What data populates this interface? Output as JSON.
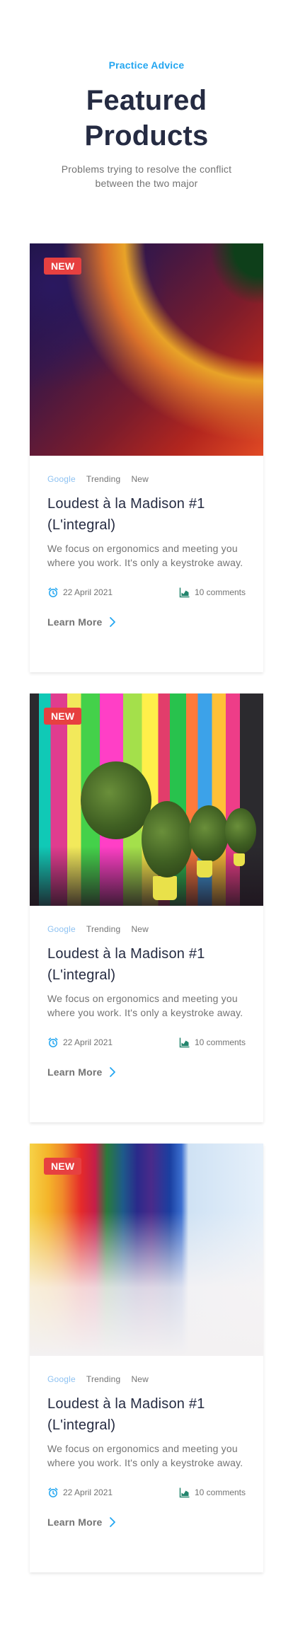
{
  "header": {
    "eyebrow": "Practice Advice",
    "title_line1": "Featured",
    "title_line2": "Products",
    "subtitle": "Problems trying to resolve the conflict between the two major"
  },
  "colors": {
    "primary": "#23A6F0",
    "heading": "#252B42",
    "muted": "#737373",
    "badge": "#E74040",
    "active_tag": "#8EC2F2",
    "icon_green": "#23856D"
  },
  "cards": [
    {
      "badge": "NEW",
      "image": "abstract-gradient-image",
      "tags": [
        "Google",
        "Trending",
        "New"
      ],
      "title": "Loudest à la Madison #1 (L'integral)",
      "description": "We focus on ergonomics and meeting you where you work. It's only a keystroke away.",
      "date": "22 April 2021",
      "comments": "10 comments",
      "cta": "Learn More",
      "date_icon": "alarm-clock-icon",
      "comments_icon": "area-chart-icon",
      "cta_icon": "chevron-right-icon"
    },
    {
      "badge": "NEW",
      "image": "colorful-glass-building-image",
      "tags": [
        "Google",
        "Trending",
        "New"
      ],
      "title": "Loudest à la Madison #1 (L'integral)",
      "description": "We focus on ergonomics and meeting you where you work. It's only a keystroke away.",
      "date": "22 April 2021",
      "comments": "10 comments",
      "cta": "Learn More",
      "date_icon": "alarm-clock-icon",
      "comments_icon": "area-chart-icon",
      "cta_icon": "chevron-right-icon"
    },
    {
      "badge": "NEW",
      "image": "paint-strokes-image",
      "tags": [
        "Google",
        "Trending",
        "New"
      ],
      "title": "Loudest à la Madison #1 (L'integral)",
      "description": "We focus on ergonomics and meeting you where you work. It's only a keystroke away.",
      "date": "22 April 2021",
      "comments": "10 comments",
      "cta": "Learn More",
      "date_icon": "alarm-clock-icon",
      "comments_icon": "area-chart-icon",
      "cta_icon": "chevron-right-icon"
    }
  ]
}
